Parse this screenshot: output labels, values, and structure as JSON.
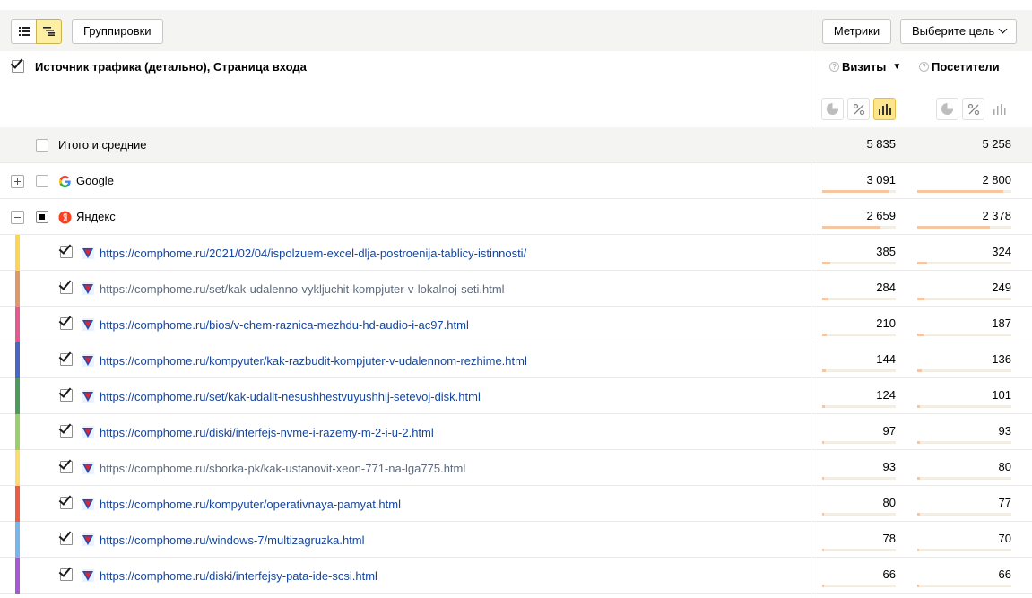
{
  "toolbar": {
    "view_list_icon": "list-icon",
    "view_tree_icon": "tree-list-icon",
    "group_label": "Группировки",
    "metrics_label": "Метрики",
    "goal_label": "Выберите цель"
  },
  "header": {
    "title": "Источник трафика (детально), Страница входа",
    "col_visits": "Визиты",
    "col_visitors": "Посетители",
    "sort_indicator": "▼",
    "help_mark": "?"
  },
  "colors": {
    "accent_yellow": "#fde58c",
    "bar_fill": "#f7c59f",
    "link": "#16459c"
  },
  "total": {
    "label": "Итого и средние",
    "visits": "5 835",
    "visitors": "5 258"
  },
  "sources": [
    {
      "label": "Google",
      "icon": "google-icon",
      "visits": "3 091",
      "visitors": "2 800",
      "visits_share": 0.53,
      "visitors_share": 0.53
    },
    {
      "label": "Яндекс",
      "icon": "yandex-icon",
      "visits": "2 659",
      "visitors": "2 378",
      "visits_share": 0.46,
      "visitors_share": 0.45
    }
  ],
  "pages": [
    {
      "url": "https://comphome.ru/2021/02/04/ispolzuem-excel-dlja-postroenija-tablicy-istinnosti/",
      "visits": "385",
      "visitors": "324",
      "visits_share": 0.066,
      "visitors_share": 0.062,
      "color": "#f9d653",
      "visited": false
    },
    {
      "url": "https://comphome.ru/set/kak-udalenno-vykljuchit-kompjuter-v-lokalnoj-seti.html",
      "visits": "284",
      "visitors": "249",
      "visits_share": 0.049,
      "visitors_share": 0.047,
      "color": "#e0986a",
      "visited": true
    },
    {
      "url": "https://comphome.ru/bios/v-chem-raznica-mezhdu-hd-audio-i-ac97.html",
      "visits": "210",
      "visitors": "187",
      "visits_share": 0.036,
      "visitors_share": 0.036,
      "color": "#e35a8e",
      "visited": false
    },
    {
      "url": "https://comphome.ru/kompyuter/kak-razbudit-kompjuter-v-udalennom-rezhime.html",
      "visits": "144",
      "visitors": "136",
      "visits_share": 0.025,
      "visitors_share": 0.026,
      "color": "#4a66c4",
      "visited": false
    },
    {
      "url": "https://comphome.ru/set/kak-udalit-nesushhestvuyushhij-setevoj-disk.html",
      "visits": "124",
      "visitors": "101",
      "visits_share": 0.021,
      "visitors_share": 0.019,
      "color": "#4c9a5d",
      "visited": false
    },
    {
      "url": "https://comphome.ru/diski/interfejs-nvme-i-razemy-m-2-i-u-2.html",
      "visits": "97",
      "visitors": "93",
      "visits_share": 0.017,
      "visitors_share": 0.018,
      "color": "#9ccf6a",
      "visited": false
    },
    {
      "url": "https://comphome.ru/sborka-pk/kak-ustanovit-xeon-771-na-lga775.html",
      "visits": "93",
      "visitors": "80",
      "visits_share": 0.016,
      "visitors_share": 0.015,
      "color": "#f9de6f",
      "visited": true
    },
    {
      "url": "https://comphome.ru/kompyuter/operativnaya-pamyat.html",
      "visits": "80",
      "visitors": "77",
      "visits_share": 0.014,
      "visitors_share": 0.015,
      "color": "#ee5b45",
      "visited": false
    },
    {
      "url": "https://comphome.ru/windows-7/multizagruzka.html",
      "visits": "78",
      "visitors": "70",
      "visits_share": 0.013,
      "visitors_share": 0.013,
      "color": "#79b4ea",
      "visited": false
    },
    {
      "url": "https://comphome.ru/diski/interfejsy-pata-ide-scsi.html",
      "visits": "66",
      "visitors": "66",
      "visits_share": 0.011,
      "visitors_share": 0.013,
      "color": "#a45ad1",
      "visited": false
    }
  ]
}
